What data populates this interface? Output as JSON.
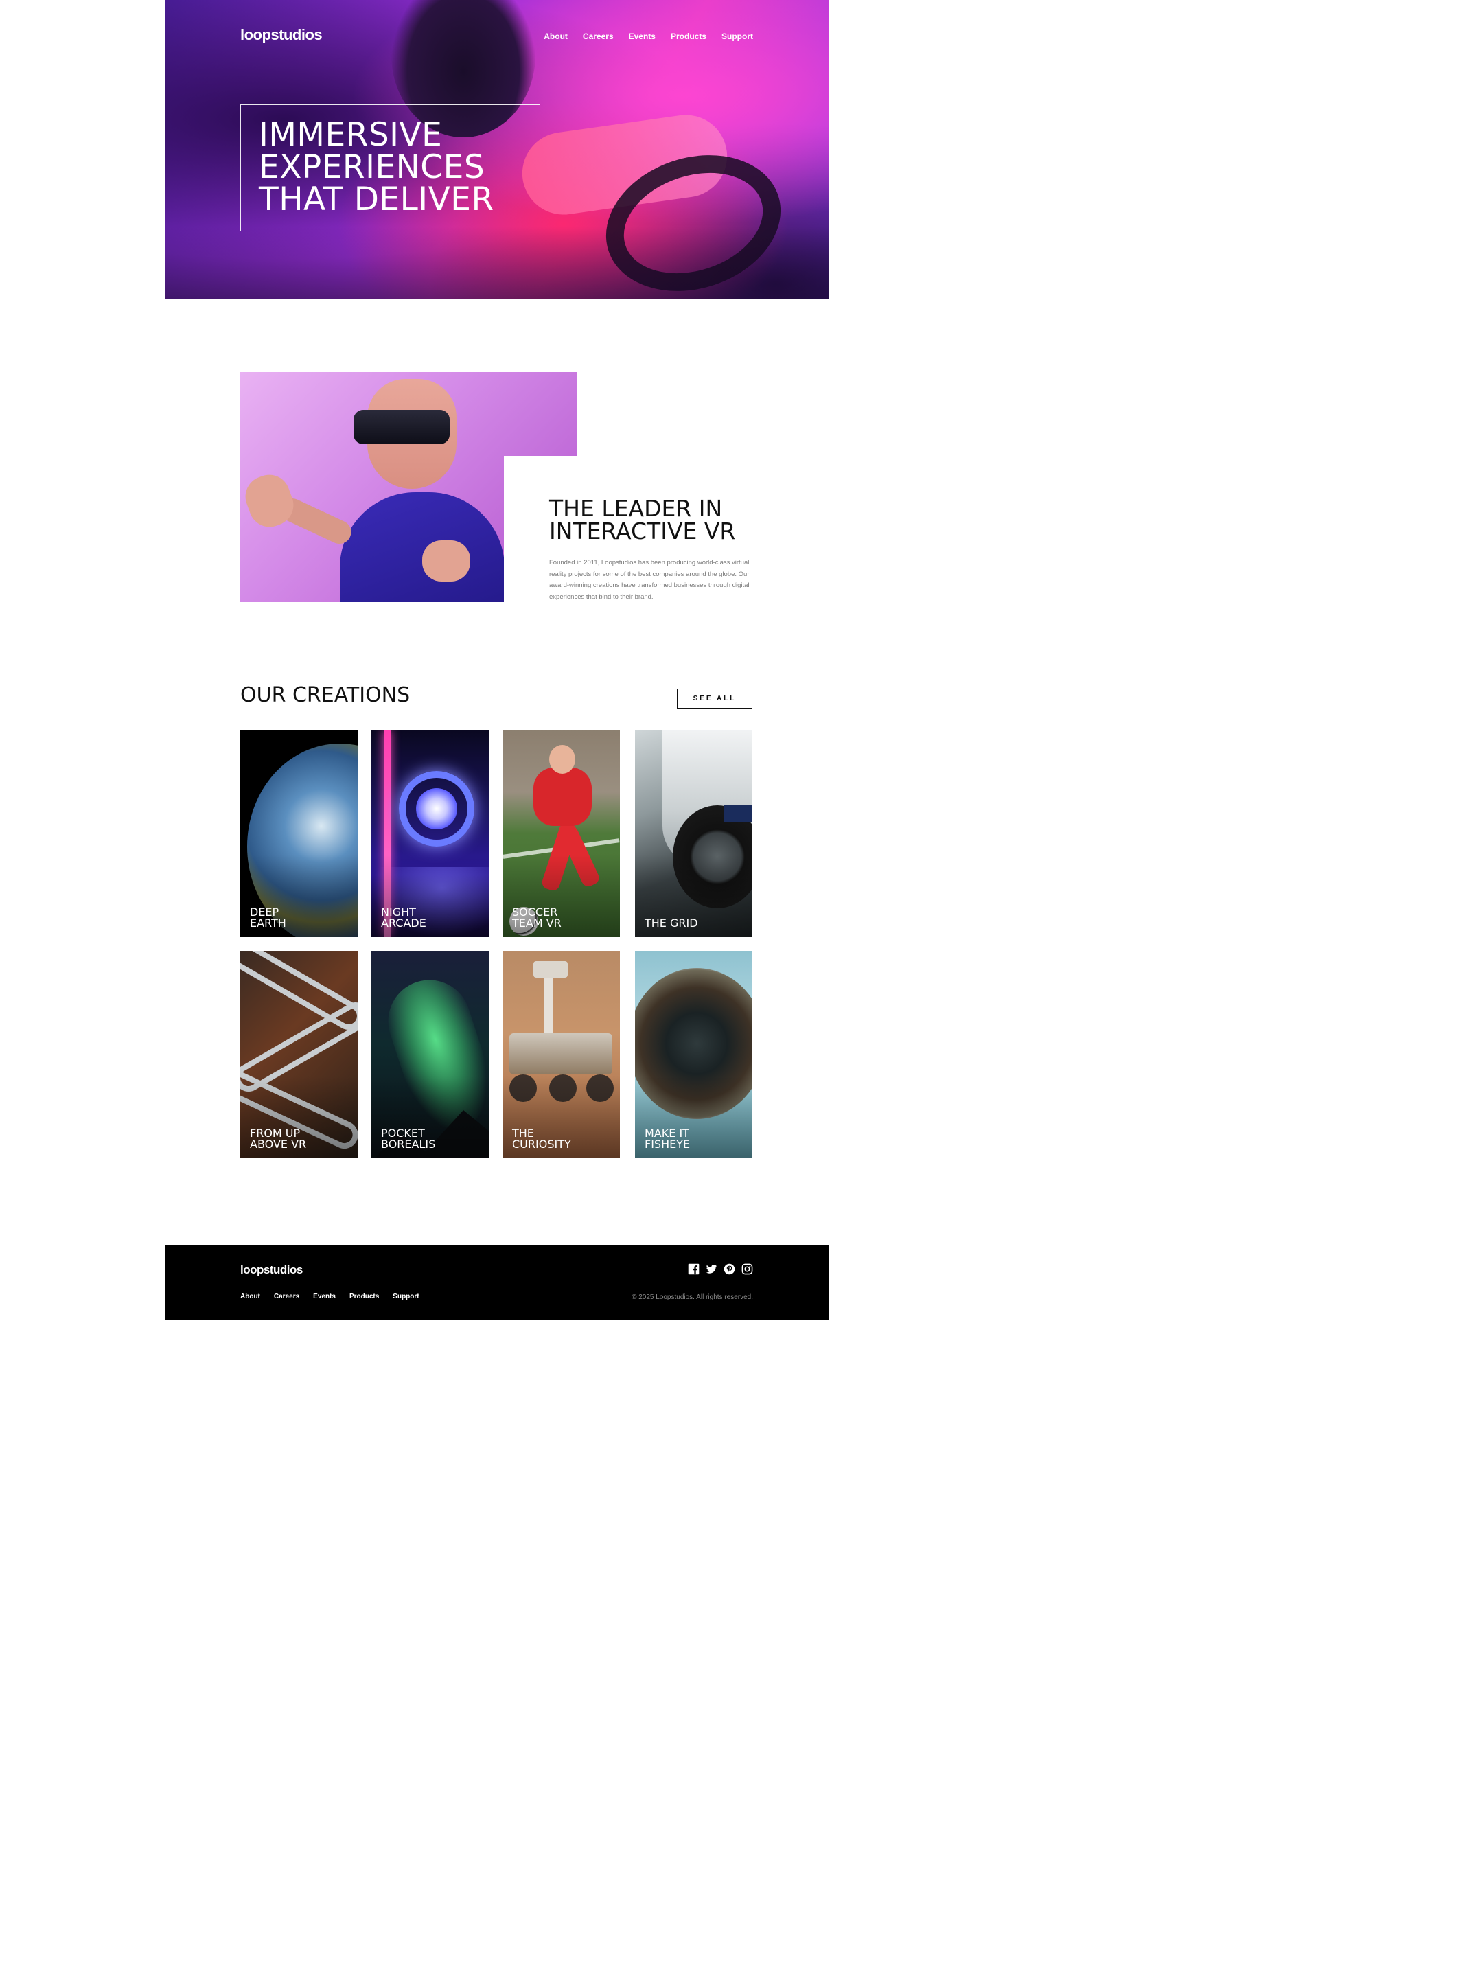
{
  "brand": {
    "logo_text": "loopstudios"
  },
  "nav": {
    "items": [
      {
        "label": "About"
      },
      {
        "label": "Careers"
      },
      {
        "label": "Events"
      },
      {
        "label": "Products"
      },
      {
        "label": "Support"
      }
    ]
  },
  "hero": {
    "title_lines": [
      "Immersive",
      "experiences",
      "that deliver"
    ]
  },
  "interactive": {
    "title_lines": [
      "The leader in",
      "interactive VR"
    ],
    "text": "Founded in 2011, Loopstudios has been producing world-class virtual reality projects for some of the best companies around the globe. Our award-winning creations have transformed businesses through digital experiences that bind to their brand."
  },
  "creations": {
    "title": "Our creations",
    "see_all_label": "See all",
    "items": [
      {
        "lines": [
          "Deep",
          "Earth"
        ]
      },
      {
        "lines": [
          "Night",
          "Arcade"
        ]
      },
      {
        "lines": [
          "Soccer",
          "Team VR"
        ]
      },
      {
        "lines": [
          "The Grid"
        ]
      },
      {
        "lines": [
          "From up",
          "above VR"
        ]
      },
      {
        "lines": [
          "Pocket",
          "Borealis"
        ]
      },
      {
        "lines": [
          "The",
          "Curiosity"
        ]
      },
      {
        "lines": [
          "Make it",
          "Fisheye"
        ]
      }
    ]
  },
  "footer": {
    "logo_text": "loopstudios",
    "nav": [
      {
        "label": "About"
      },
      {
        "label": "Careers"
      },
      {
        "label": "Events"
      },
      {
        "label": "Products"
      },
      {
        "label": "Support"
      }
    ],
    "social": [
      {
        "icon": "facebook-icon"
      },
      {
        "icon": "twitter-icon"
      },
      {
        "icon": "pinterest-icon"
      },
      {
        "icon": "instagram-icon"
      }
    ],
    "copyright": "© 2025 Loopstudios. All rights reserved."
  },
  "colors": {
    "page_background": "#ffffff",
    "footer_background": "#000000",
    "text_dark": "#111111",
    "text_muted": "#7a7a7a"
  }
}
